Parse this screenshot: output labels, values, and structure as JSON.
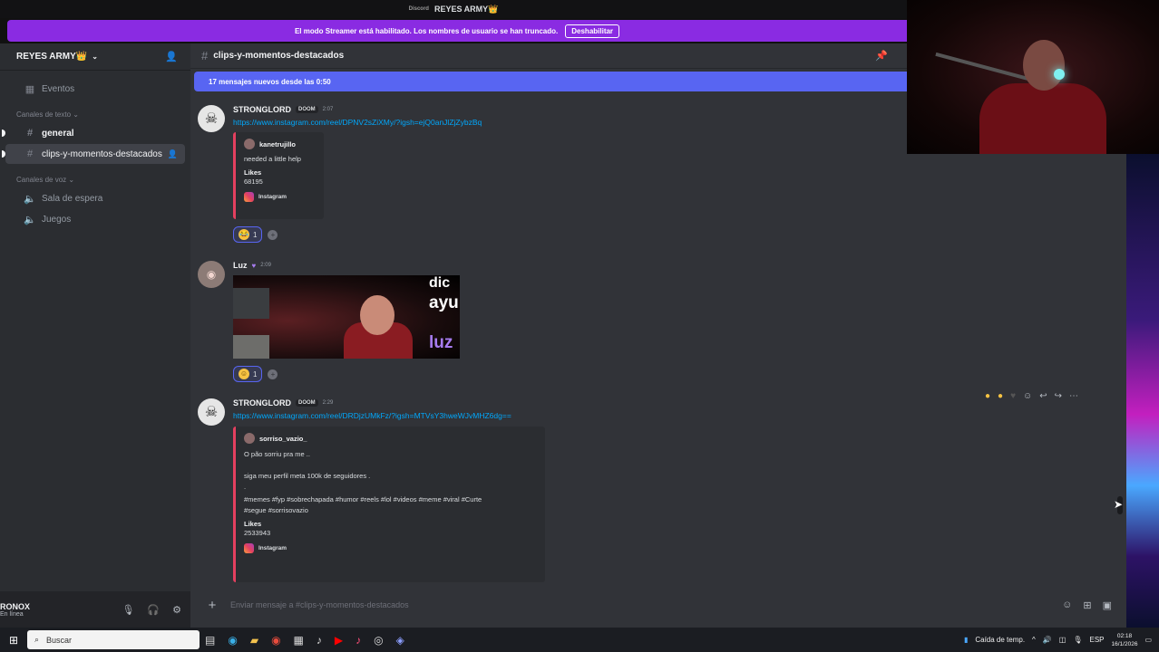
{
  "titlebar": {
    "title": "REYES ARMY👑",
    "app": "Discord"
  },
  "streamer": {
    "message": "El modo Streamer está habilitado. Los nombres de usuario se han truncado.",
    "button": "Deshabilitar"
  },
  "server": {
    "name": "REYES ARMY👑"
  },
  "sidebar": {
    "events": "Eventos",
    "text_category": "Canales de texto",
    "text_channels": [
      {
        "name": "general"
      },
      {
        "name": "clips-y-momentos-destacados"
      }
    ],
    "voice_category": "Canales de voz",
    "voice_channels": [
      {
        "name": "Sala de espera"
      },
      {
        "name": "Juegos"
      }
    ]
  },
  "user": {
    "name": "RONOX",
    "status": "En línea"
  },
  "channel": {
    "name": "clips-y-momentos-destacados"
  },
  "new_messages": "17 mensajes nuevos desde las 0:50",
  "messages": [
    {
      "author": "STRONGLORD",
      "tag": "DOOM",
      "time": "2:07",
      "link": "https://www.instagram.com/reel/DPNV2sZiXMy/?igsh=ejQ0anJlZjZybzBq",
      "embed": {
        "author": "kanetrujillo",
        "text": "needed a little help",
        "likes_label": "Likes",
        "likes": "68195",
        "footer": "Instagram"
      },
      "reaction_count": "1"
    },
    {
      "author": "Luz",
      "time": "2:09",
      "captions": [
        "dic",
        "ayu",
        "luz"
      ],
      "reaction_count": "1"
    },
    {
      "author": "STRONGLORD",
      "tag": "DOOM",
      "time": "2:29",
      "link": "https://www.instagram.com/reel/DRDjzUMkFz/?igsh=MTVsY3hweWJvMHZ6dg==",
      "embed": {
        "author": "sorriso_vazio_",
        "line1": "O pão sorriu pra me ..",
        "line2": "siga meu perfil meta 100k de seguidores .",
        "line3": ".",
        "line4": "#memes #fyp #sobrechapada #humor #reels #lol #videos #meme #viral #Curte",
        "line5": "#segue #sorrisovazio",
        "likes_label": "Likes",
        "likes": "2533943",
        "footer": "Instagram"
      }
    }
  ],
  "input": {
    "placeholder": "Enviar mensaje a #clips-y-momentos-destacados"
  },
  "taskbar": {
    "search": "Buscar",
    "weather": "Caída de temp.",
    "lang": "ESP",
    "time": "02:18",
    "date": "16/1/2026"
  }
}
